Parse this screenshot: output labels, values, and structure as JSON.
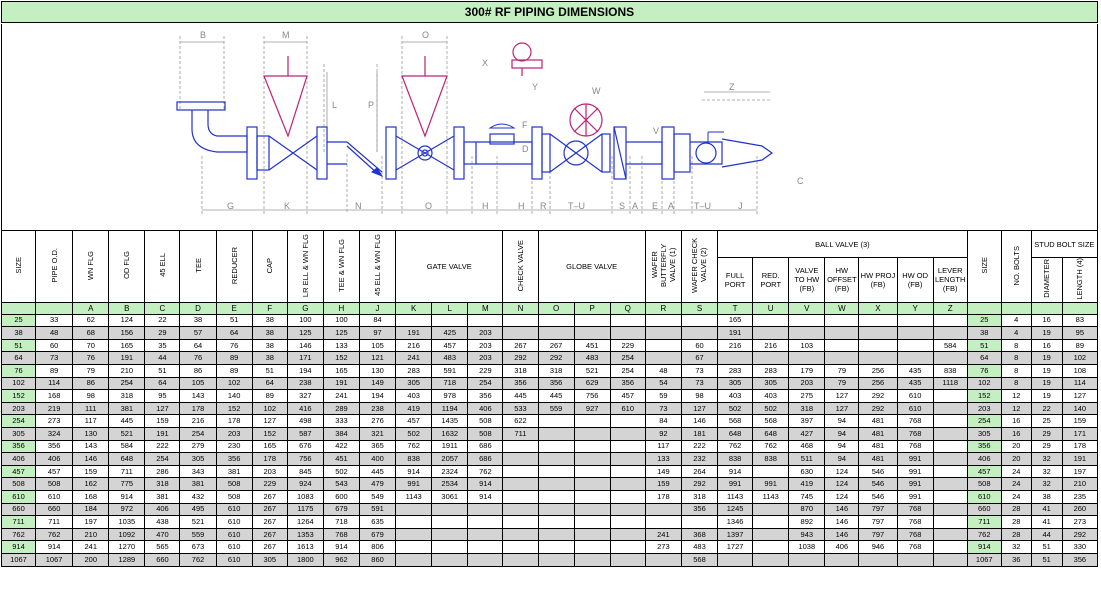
{
  "title": "300# RF PIPING DIMENSIONS",
  "drawing_labels": [
    "B",
    "M",
    "O",
    "X",
    "Y",
    "W",
    "Z",
    "L",
    "P",
    "D",
    "F",
    "V",
    "C",
    "G",
    "K",
    "N",
    "O",
    "H",
    "H",
    "R",
    "T–U",
    "S",
    "A",
    "E",
    "A",
    "T–U",
    "J"
  ],
  "headers": {
    "size": "SIZE",
    "pipe_od": "PIPE O.D.",
    "wn_flg": "WN FLG",
    "od_flg": "OD FLG",
    "ell45": "45 ELL",
    "tee": "TEE",
    "reducer": "REDUCER",
    "cap": "CAP",
    "lr_ell": "LR ELL & WN FLG",
    "tee_wn": "TEE & WN FLG",
    "ell45_wn": "45 ELL & WN FLG",
    "gate_valve": "GATE VALVE",
    "check_valve": "CHECK VALVE",
    "globe_valve": "GLOBE VALVE",
    "wafer_bfly": "WAFER BUTTERFLY VALVE (1)",
    "wafer_check": "WAFER CHECK VALVE (2)",
    "ball_valve": "BALL VALVE (3)",
    "full_port": "FULL PORT",
    "red_port": "RED. PORT",
    "valve_hw": "VALVE TO HW (FB)",
    "hw_offset": "HW OFFSET (FB)",
    "hw_proj": "HW PROJ (FB)",
    "hw_od": "HW OD (FB)",
    "lever_len": "LEVER LENGTH (FB)",
    "size2": "SIZE",
    "no_bolts": "NO. BOLTS",
    "stud_bolt": "STUD BOLT SIZE",
    "diameter": "DIAMETER",
    "length": "LENGTH (4)"
  },
  "letters": [
    "A",
    "B",
    "C",
    "D",
    "E",
    "F",
    "G",
    "H",
    "J",
    "K",
    "L",
    "M",
    "N",
    "O",
    "P",
    "Q",
    "R",
    "S",
    "T",
    "U",
    "V",
    "W",
    "X",
    "Y",
    "Z"
  ],
  "rows": [
    [
      "25",
      "33",
      "62",
      "124",
      "22",
      "38",
      "51",
      "38",
      "100",
      "100",
      "84",
      "",
      "",
      "",
      "",
      "",
      "",
      "",
      "",
      "",
      "165",
      "",
      "",
      "",
      "",
      "",
      "",
      "25",
      "4",
      "16",
      "83"
    ],
    [
      "38",
      "48",
      "68",
      "156",
      "29",
      "57",
      "64",
      "38",
      "125",
      "125",
      "97",
      "191",
      "425",
      "203",
      "",
      "",
      "",
      "",
      "",
      "",
      "191",
      "",
      "",
      "",
      "",
      "",
      "",
      "38",
      "4",
      "19",
      "95"
    ],
    [
      "51",
      "60",
      "70",
      "165",
      "35",
      "64",
      "76",
      "38",
      "146",
      "133",
      "105",
      "216",
      "457",
      "203",
      "267",
      "267",
      "451",
      "229",
      "",
      "60",
      "216",
      "216",
      "103",
      "",
      "",
      "",
      "584",
      "51",
      "8",
      "16",
      "89"
    ],
    [
      "64",
      "73",
      "76",
      "191",
      "44",
      "76",
      "89",
      "38",
      "171",
      "152",
      "121",
      "241",
      "483",
      "203",
      "292",
      "292",
      "483",
      "254",
      "",
      "67",
      "",
      "",
      "",
      "",
      "",
      "",
      "",
      "64",
      "8",
      "19",
      "102"
    ],
    [
      "76",
      "89",
      "79",
      "210",
      "51",
      "86",
      "89",
      "51",
      "194",
      "165",
      "130",
      "283",
      "591",
      "229",
      "318",
      "318",
      "521",
      "254",
      "48",
      "73",
      "283",
      "283",
      "179",
      "79",
      "256",
      "435",
      "838",
      "76",
      "8",
      "19",
      "108"
    ],
    [
      "102",
      "114",
      "86",
      "254",
      "64",
      "105",
      "102",
      "64",
      "238",
      "191",
      "149",
      "305",
      "718",
      "254",
      "356",
      "356",
      "629",
      "356",
      "54",
      "73",
      "305",
      "305",
      "203",
      "79",
      "256",
      "435",
      "1118",
      "102",
      "8",
      "19",
      "114"
    ],
    [
      "152",
      "168",
      "98",
      "318",
      "95",
      "143",
      "140",
      "89",
      "327",
      "241",
      "194",
      "403",
      "978",
      "356",
      "445",
      "445",
      "756",
      "457",
      "59",
      "98",
      "403",
      "403",
      "275",
      "127",
      "292",
      "610",
      "",
      "152",
      "12",
      "19",
      "127"
    ],
    [
      "203",
      "219",
      "111",
      "381",
      "127",
      "178",
      "152",
      "102",
      "416",
      "289",
      "238",
      "419",
      "1194",
      "406",
      "533",
      "559",
      "927",
      "610",
      "73",
      "127",
      "502",
      "502",
      "318",
      "127",
      "292",
      "610",
      "",
      "203",
      "12",
      "22",
      "140"
    ],
    [
      "254",
      "273",
      "117",
      "445",
      "159",
      "216",
      "178",
      "127",
      "498",
      "333",
      "276",
      "457",
      "1435",
      "508",
      "622",
      "",
      "",
      "",
      "84",
      "146",
      "568",
      "568",
      "397",
      "94",
      "481",
      "768",
      "",
      "254",
      "16",
      "25",
      "159"
    ],
    [
      "305",
      "324",
      "130",
      "521",
      "191",
      "254",
      "203",
      "152",
      "587",
      "384",
      "321",
      "502",
      "1632",
      "508",
      "711",
      "",
      "",
      "",
      "92",
      "181",
      "648",
      "648",
      "427",
      "94",
      "481",
      "768",
      "",
      "305",
      "16",
      "29",
      "171"
    ],
    [
      "356",
      "356",
      "143",
      "584",
      "222",
      "279",
      "230",
      "165",
      "676",
      "422",
      "365",
      "762",
      "1911",
      "686",
      "",
      "",
      "",
      "",
      "117",
      "222",
      "762",
      "762",
      "468",
      "94",
      "481",
      "768",
      "",
      "356",
      "20",
      "29",
      "178"
    ],
    [
      "406",
      "406",
      "146",
      "648",
      "254",
      "305",
      "356",
      "178",
      "756",
      "451",
      "400",
      "838",
      "2057",
      "686",
      "",
      "",
      "",
      "",
      "133",
      "232",
      "838",
      "838",
      "511",
      "94",
      "481",
      "991",
      "",
      "406",
      "20",
      "32",
      "191"
    ],
    [
      "457",
      "457",
      "159",
      "711",
      "286",
      "343",
      "381",
      "203",
      "845",
      "502",
      "445",
      "914",
      "2324",
      "762",
      "",
      "",
      "",
      "",
      "149",
      "264",
      "914",
      "",
      "630",
      "124",
      "546",
      "991",
      "",
      "457",
      "24",
      "32",
      "197"
    ],
    [
      "508",
      "508",
      "162",
      "775",
      "318",
      "381",
      "508",
      "229",
      "924",
      "543",
      "479",
      "991",
      "2534",
      "914",
      "",
      "",
      "",
      "",
      "159",
      "292",
      "991",
      "991",
      "419",
      "124",
      "546",
      "991",
      "",
      "508",
      "24",
      "32",
      "210"
    ],
    [
      "610",
      "610",
      "168",
      "914",
      "381",
      "432",
      "508",
      "267",
      "1083",
      "600",
      "549",
      "1143",
      "3061",
      "914",
      "",
      "",
      "",
      "",
      "178",
      "318",
      "1143",
      "1143",
      "745",
      "124",
      "546",
      "991",
      "",
      "610",
      "24",
      "38",
      "235"
    ],
    [
      "660",
      "660",
      "184",
      "972",
      "406",
      "495",
      "610",
      "267",
      "1175",
      "679",
      "591",
      "",
      "",
      "",
      "",
      "",
      "",
      "",
      "",
      "356",
      "1245",
      "",
      "870",
      "146",
      "797",
      "768",
      "",
      "660",
      "28",
      "41",
      "260"
    ],
    [
      "711",
      "711",
      "197",
      "1035",
      "438",
      "521",
      "610",
      "267",
      "1264",
      "718",
      "635",
      "",
      "",
      "",
      "",
      "",
      "",
      "",
      "",
      "",
      "1346",
      "",
      "892",
      "146",
      "797",
      "768",
      "",
      "711",
      "28",
      "41",
      "273"
    ],
    [
      "762",
      "762",
      "210",
      "1092",
      "470",
      "559",
      "610",
      "267",
      "1353",
      "768",
      "679",
      "",
      "",
      "",
      "",
      "",
      "",
      "",
      "241",
      "368",
      "1397",
      "",
      "943",
      "146",
      "797",
      "768",
      "",
      "762",
      "28",
      "44",
      "292"
    ],
    [
      "914",
      "914",
      "241",
      "1270",
      "565",
      "673",
      "610",
      "267",
      "1613",
      "914",
      "806",
      "",
      "",
      "",
      "",
      "",
      "",
      "",
      "273",
      "483",
      "1727",
      "",
      "1038",
      "406",
      "946",
      "768",
      "",
      "914",
      "32",
      "51",
      "330"
    ],
    [
      "1067",
      "1067",
      "200",
      "1289",
      "660",
      "762",
      "610",
      "305",
      "1800",
      "962",
      "860",
      "",
      "",
      "",
      "",
      "",
      "",
      "",
      "",
      "568",
      "",
      "",
      "",
      "",
      "",
      "",
      "",
      "1067",
      "36",
      "51",
      "356"
    ]
  ]
}
